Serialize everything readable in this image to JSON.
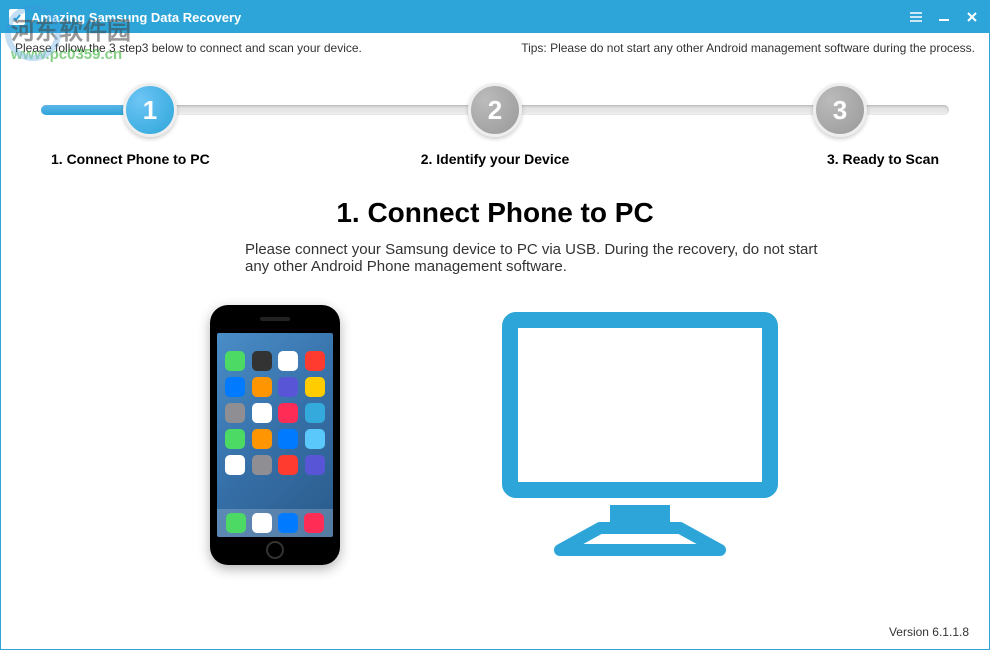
{
  "titleBar": {
    "appName": "Amazing Samsung Data Recovery"
  },
  "infoBar": {
    "instructions": "Please follow the 3 step3 below to connect and scan your device.",
    "tips": "Tips: Please do not start any other Android management software during the process."
  },
  "steps": {
    "step1": {
      "num": "1",
      "label": "1. Connect Phone to PC"
    },
    "step2": {
      "num": "2",
      "label": "2. Identify your Device"
    },
    "step3": {
      "num": "3",
      "label": "3. Ready to Scan"
    }
  },
  "main": {
    "title": "1. Connect Phone to PC",
    "description": "Please connect your Samsung device to PC via USB. During the recovery, do not start any other Android Phone management software."
  },
  "footer": {
    "version": "Version 6.1.1.8"
  },
  "watermark": {
    "title": "河东软件园",
    "url": "www.pc0359.cn"
  },
  "colors": {
    "accent": "#2da5d9"
  }
}
